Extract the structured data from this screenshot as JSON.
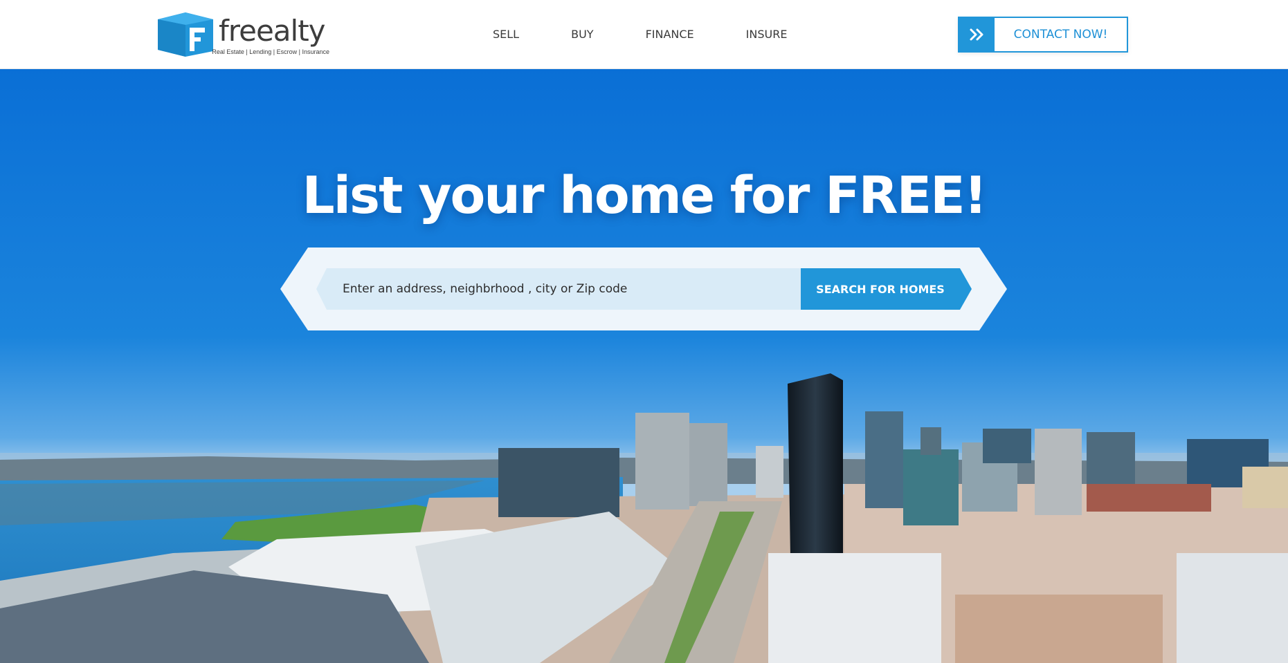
{
  "brand": {
    "name": "freealty",
    "tagline": "Real Estate | Lending | Escrow | Insurance",
    "logo_icon": "cube-f-logo-icon",
    "color": "#2196d9"
  },
  "nav": {
    "items": [
      {
        "label": "SELL"
      },
      {
        "label": "BUY"
      },
      {
        "label": "FINANCE"
      },
      {
        "label": "INSURE"
      }
    ]
  },
  "contact": {
    "label": "CONTACT NOW!",
    "icon": "double-chevron-right-icon"
  },
  "hero": {
    "title": "List your home for FREE!",
    "background": "san-diego-skyline-photo",
    "search": {
      "placeholder": "Enter an address, neighbrhood , city or Zip code",
      "value": "",
      "button_label": "SEARCH FOR HOMES"
    }
  },
  "colors": {
    "accent": "#2196d9",
    "sky_top": "#0a6fd6",
    "text_dark": "#3a3a3a"
  }
}
